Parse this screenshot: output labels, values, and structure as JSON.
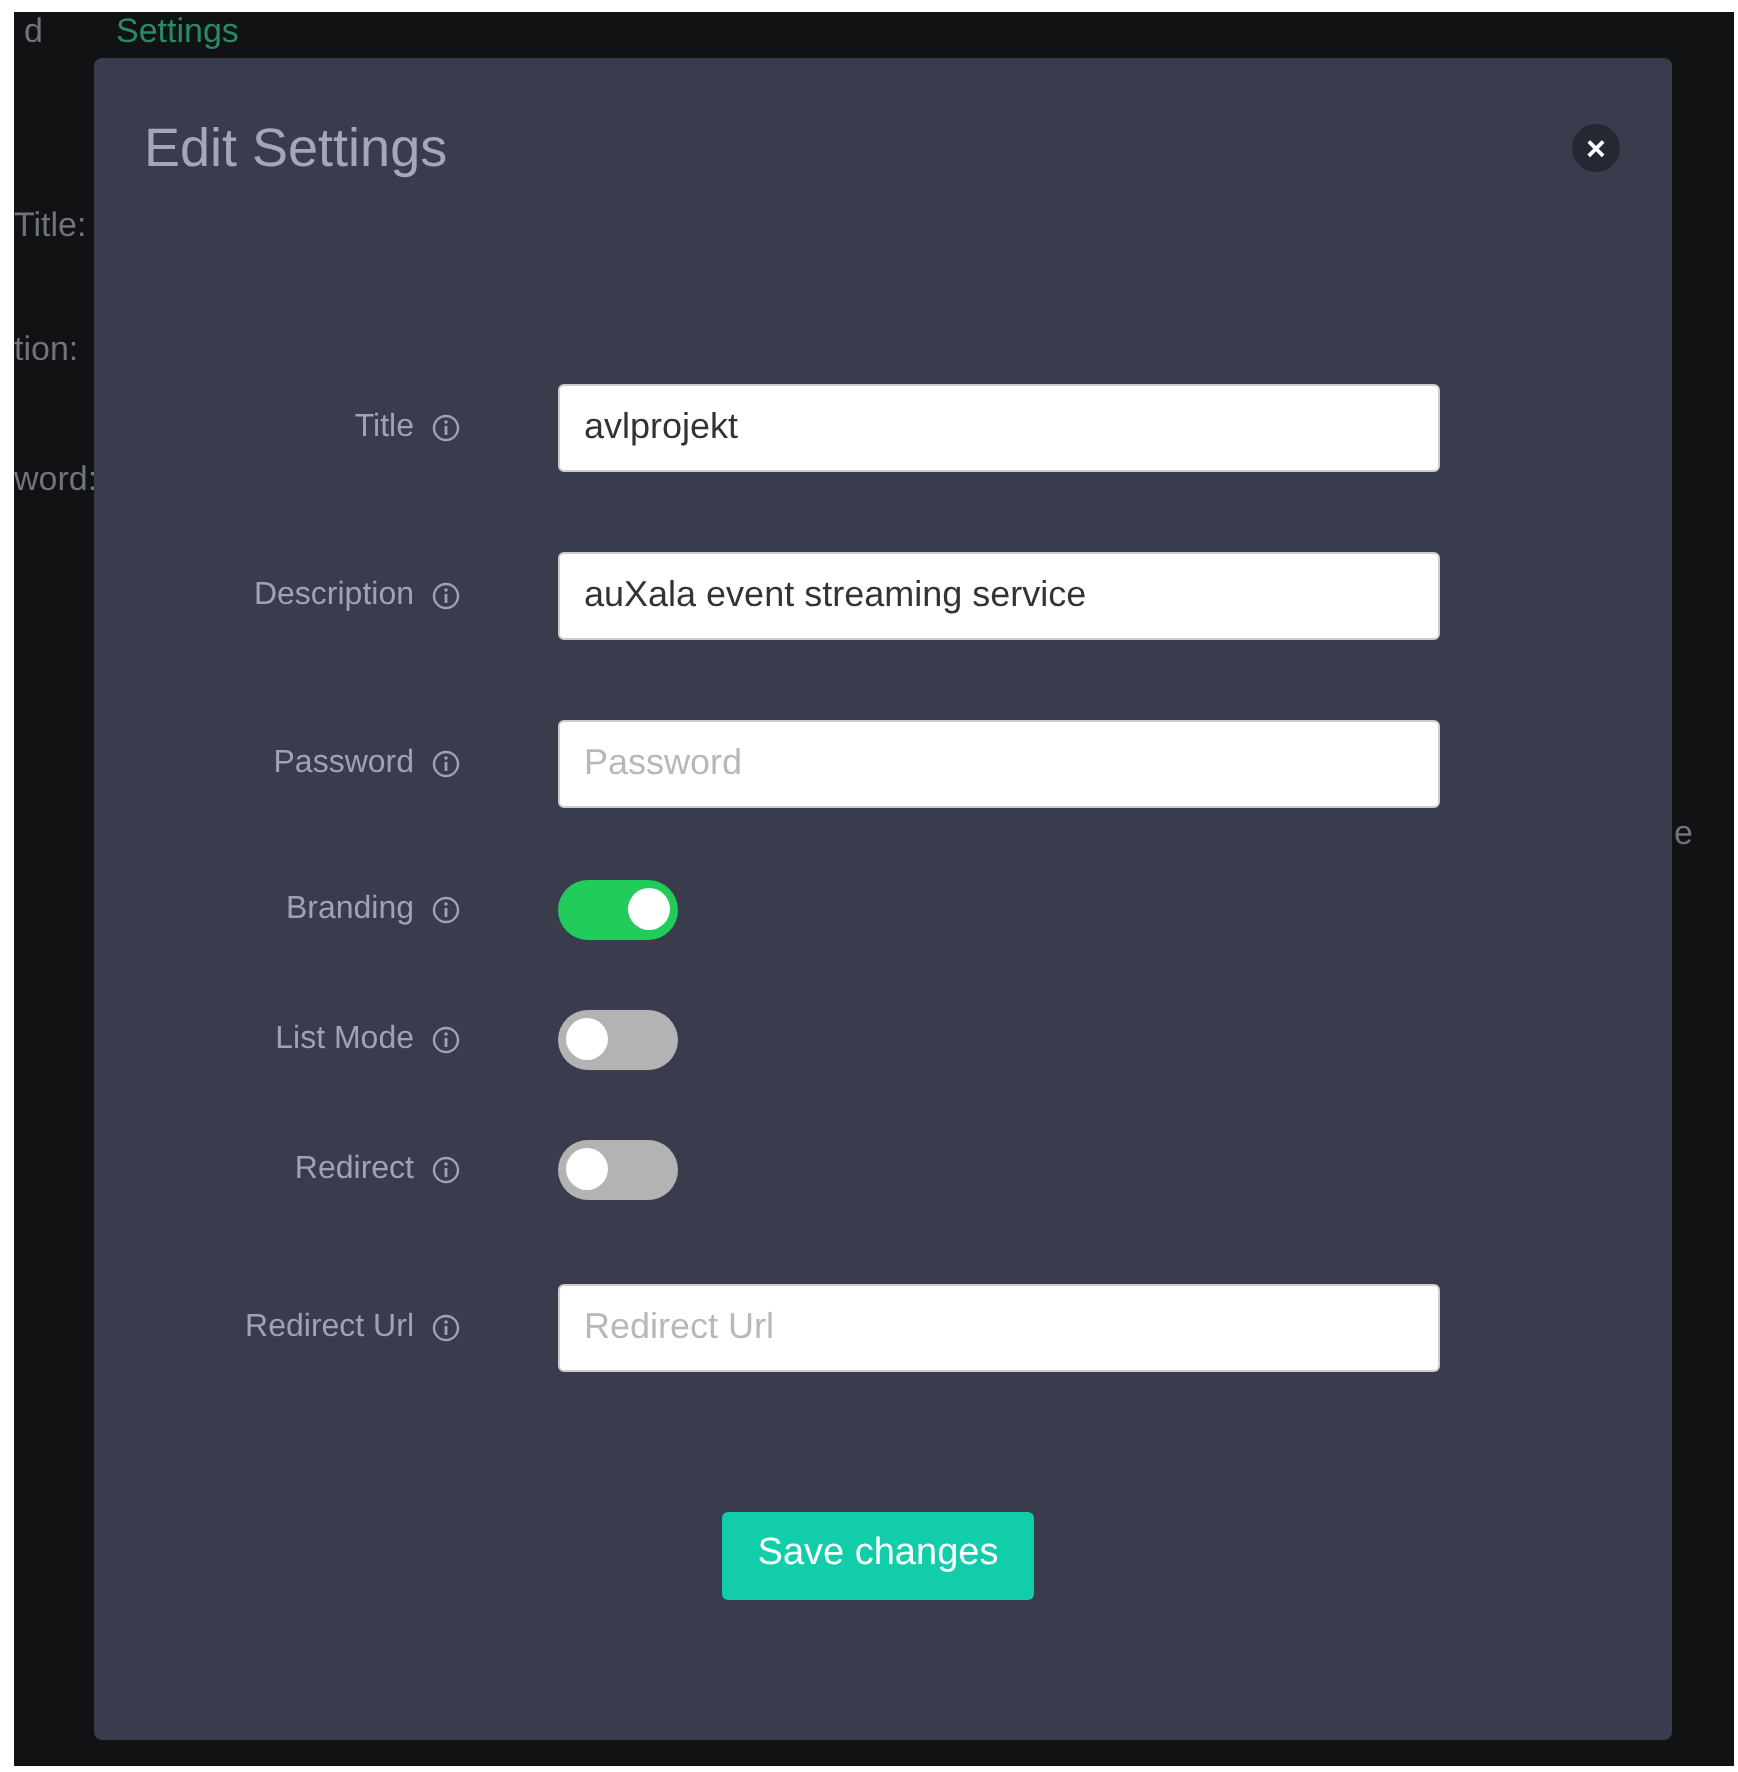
{
  "background": {
    "texts": [
      {
        "text": "d",
        "kind": "plain"
      },
      {
        "text": "Settings",
        "kind": "link"
      },
      {
        "text": "Title:",
        "kind": "plain"
      },
      {
        "text": "tion:",
        "kind": "plain"
      },
      {
        "text": "word:",
        "kind": "plain"
      },
      {
        "text": "e",
        "kind": "plain"
      }
    ]
  },
  "modal": {
    "title": "Edit Settings",
    "close": "×",
    "fields": [
      {
        "label": "Title",
        "kind": "text",
        "value": "avlprojekt"
      },
      {
        "label": "Description",
        "kind": "text",
        "value": "auXala event streaming service"
      },
      {
        "label": "Password",
        "kind": "text",
        "placeholder": "Password"
      },
      {
        "label": "Branding",
        "kind": "toggle",
        "on": true
      },
      {
        "label": "List Mode",
        "kind": "toggle",
        "on": false
      },
      {
        "label": "Redirect",
        "kind": "toggle",
        "on": false
      },
      {
        "label": "Redirect Url",
        "kind": "text",
        "placeholder": "Redirect Url"
      }
    ],
    "save_button": "Save changes"
  }
}
